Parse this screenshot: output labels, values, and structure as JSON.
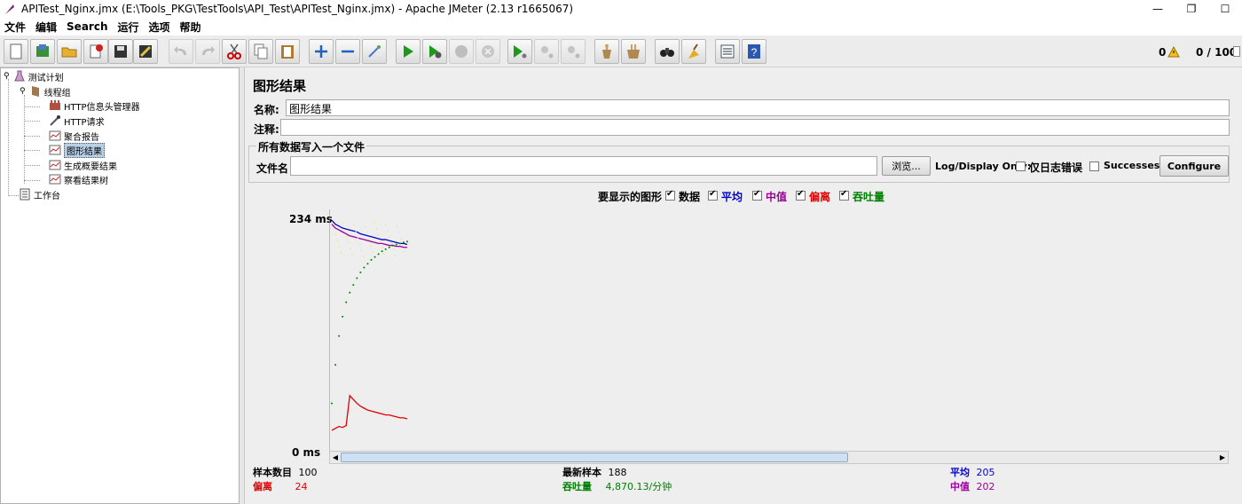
{
  "window": {
    "title": "APITest_Nginx.jmx (E:\\Tools_PKG\\TestTools\\API_Test\\APITest_Nginx.jmx) - Apache JMeter (2.13 r1665067)",
    "minimize": "—",
    "restore": "❐",
    "close": "☐"
  },
  "menu": [
    "文件",
    "编辑",
    "Search",
    "运行",
    "选项",
    "帮助"
  ],
  "toolbar": {
    "warning_count": "0",
    "thread_status": "0 / 100"
  },
  "tree": {
    "root": "测试计划",
    "thread_group": "线程组",
    "children": [
      "HTTP信息头管理器",
      "HTTP请求",
      "聚合报告",
      "图形结果",
      "生成概要结果",
      "察看结果树"
    ],
    "workbench": "工作台"
  },
  "panel": {
    "title": "图形结果",
    "name_label": "名称:",
    "name_value": "图形结果",
    "comment_label": "注释:",
    "comment_value": "",
    "file_group_title": "所有数据写入一个文件",
    "filename_label": "文件名",
    "filename_value": "",
    "browse_button": "浏览...",
    "log_display_label": "Log/Display Only:",
    "errors_only_label": "仅日志错误",
    "successes_label": "Successes",
    "configure_button": "Configure"
  },
  "graph_options": {
    "label": "要显示的图形",
    "items": [
      {
        "label": "数据",
        "color": "#000000",
        "checked": true
      },
      {
        "label": "平均",
        "color": "#0000cc",
        "checked": true
      },
      {
        "label": "中值",
        "color": "#990099",
        "checked": true
      },
      {
        "label": "偏离",
        "color": "#e00000",
        "checked": true
      },
      {
        "label": "吞吐量",
        "color": "#008000",
        "checked": true
      }
    ]
  },
  "chart_data": {
    "type": "line",
    "ymax_label": "234  ms",
    "ymin_label": "0  ms",
    "ylim": [
      0,
      234
    ],
    "samples": 100,
    "series": [
      {
        "name": "平均",
        "color": "#0000cc",
        "values": [
          230,
          226,
          224,
          222,
          221,
          220,
          219,
          218,
          216,
          215,
          214,
          213,
          212,
          211,
          210,
          210,
          209,
          208,
          207,
          206,
          206,
          205
        ]
      },
      {
        "name": "中值",
        "color": "#990099",
        "values": [
          226,
          222,
          220,
          218,
          216,
          214,
          213,
          212,
          211,
          210,
          209,
          208,
          207,
          206,
          206,
          205,
          204,
          204,
          203,
          203,
          202,
          202
        ]
      },
      {
        "name": "偏离",
        "color": "#e00000",
        "values": [
          12,
          14,
          16,
          15,
          17,
          48,
          44,
          40,
          37,
          35,
          33,
          32,
          31,
          30,
          29,
          28,
          28,
          27,
          26,
          25,
          25,
          24
        ]
      },
      {
        "name": "吞吐量",
        "color": "#008000",
        "values": [
          40,
          80,
          110,
          130,
          145,
          155,
          163,
          170,
          176,
          181,
          185,
          189,
          192,
          195,
          198,
          200,
          202,
          204,
          205,
          206,
          207,
          208
        ]
      }
    ]
  },
  "stats": {
    "samples_label": "样本数目",
    "samples_value": "100",
    "deviation_label": "偏离",
    "deviation_value": "24",
    "latest_label": "最新样本",
    "latest_value": "188",
    "throughput_label": "吞吐量",
    "throughput_value": "4,870.13/分钟",
    "average_label": "平均",
    "average_value": "205",
    "median_label": "中值",
    "median_value": "202"
  }
}
